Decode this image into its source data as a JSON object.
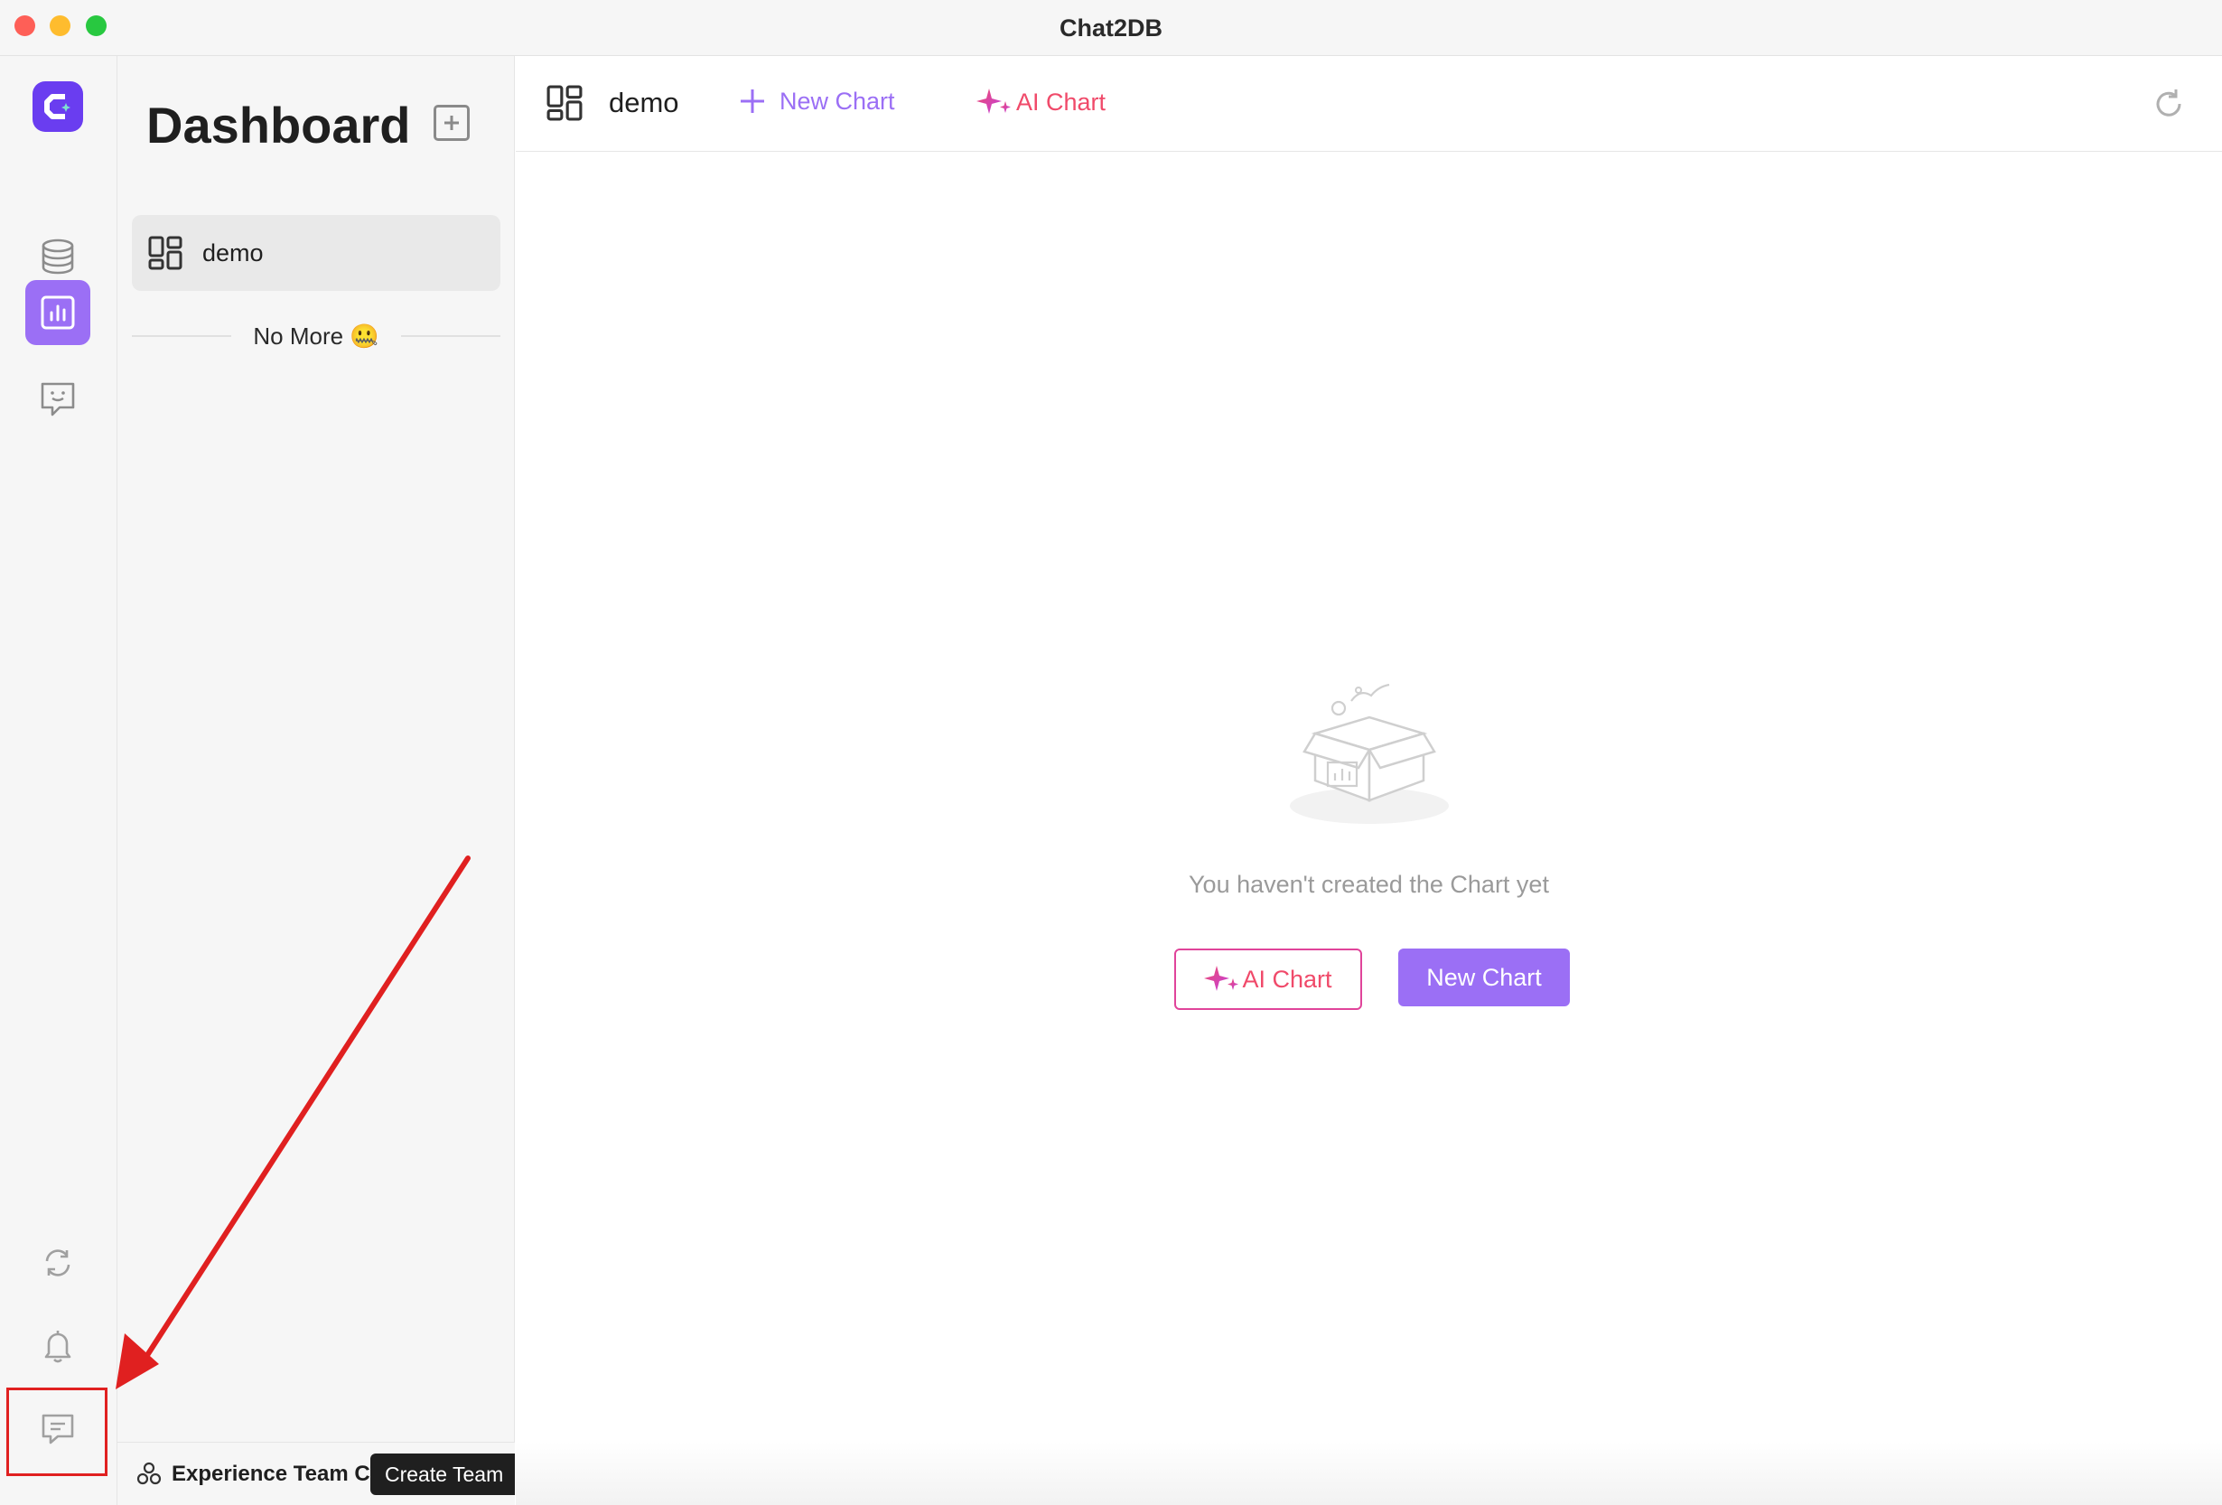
{
  "window": {
    "title": "Chat2DB"
  },
  "rail": {
    "items": [
      {
        "name": "database",
        "icon": "database-icon"
      },
      {
        "name": "dashboard",
        "icon": "bar-chart-icon",
        "active": true
      },
      {
        "name": "chat",
        "icon": "chat-bot-icon"
      }
    ],
    "bottom_items": [
      {
        "name": "sync",
        "icon": "sync-icon"
      },
      {
        "name": "notifications",
        "icon": "bell-icon"
      },
      {
        "name": "feedback",
        "icon": "message-icon"
      }
    ]
  },
  "panel": {
    "title": "Dashboard",
    "items": [
      {
        "label": "demo"
      }
    ],
    "end_text": "No More 🤐",
    "team_name": "Experience Team C...",
    "create_team_label": "Create Team"
  },
  "main": {
    "dashboard_title": "demo",
    "new_chart_label": "New Chart",
    "ai_chart_label": "AI Chart",
    "empty_text": "You haven't created the Chart yet",
    "empty_ai_button": "AI Chart",
    "empty_new_button": "New Chart"
  },
  "colors": {
    "accent": "#9b6ff5",
    "logo": "#6a3df0",
    "ai_gradient_start": "#f04a6a",
    "ai_gradient_end": "#c23fe0",
    "annotation": "#e02020"
  }
}
